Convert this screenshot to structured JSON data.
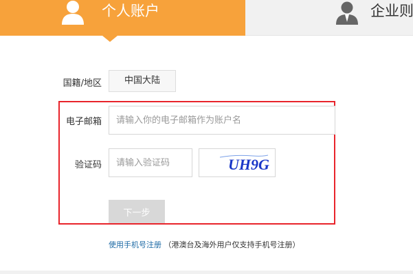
{
  "tabs": {
    "personal": {
      "label": "个人账户",
      "icon": "user-icon",
      "color": "#f7a23b"
    },
    "enterprise": {
      "label": "企业则",
      "icon": "business-user-icon",
      "color": "#f1f1f1"
    }
  },
  "form": {
    "nationality": {
      "label": "国籍/地区",
      "value": "中国大陆"
    },
    "email": {
      "label": "电子邮箱",
      "placeholder": "请输入你的电子邮箱作为账户名"
    },
    "code": {
      "label": "验证码",
      "placeholder": "请输入验证码",
      "captcha_text": "UH9G"
    },
    "next_label": "下一步"
  },
  "footer": {
    "phone_link": "使用手机号注册",
    "note": "（港澳台及海外用户仅支持手机号注册）"
  },
  "colors": {
    "highlight": "#e8232a",
    "link": "#1d6aa5"
  }
}
